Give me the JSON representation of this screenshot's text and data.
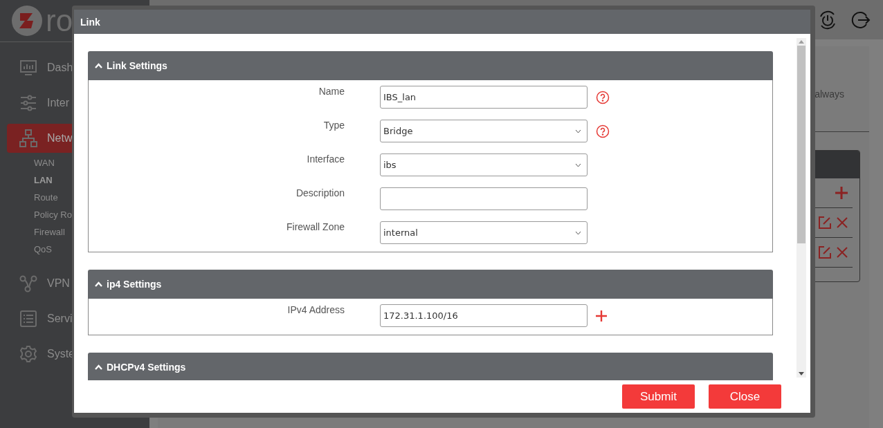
{
  "sidebar": {
    "logo_text": "ro",
    "nav": [
      {
        "label": "Dash",
        "selected": false
      },
      {
        "label": "Inter",
        "selected": false
      },
      {
        "label": "Netw",
        "selected": true,
        "children": [
          {
            "label": "WAN",
            "selected": false
          },
          {
            "label": "LAN",
            "selected": true
          },
          {
            "label": "Route",
            "selected": false
          },
          {
            "label": "Policy Ro",
            "selected": false
          },
          {
            "label": "Firewall",
            "selected": false
          },
          {
            "label": "QoS",
            "selected": false
          }
        ]
      },
      {
        "label": "VPN",
        "selected": false
      },
      {
        "label": "Servi",
        "selected": false
      },
      {
        "label": "Syste",
        "selected": false
      }
    ]
  },
  "background": {
    "text": "always",
    "rows": [
      {
        "kind": "add"
      },
      {
        "kind": "edit"
      },
      {
        "kind": "edit"
      }
    ]
  },
  "modal": {
    "title": "Link",
    "sections": [
      {
        "title": "Link Settings",
        "expanded": true,
        "fields": [
          {
            "label": "Name",
            "kind": "text",
            "value": "IBS_lan",
            "help": true
          },
          {
            "label": "Type",
            "kind": "select",
            "value": "Bridge",
            "help": true
          },
          {
            "label": "Interface",
            "kind": "select",
            "value": "ibs",
            "help": false
          },
          {
            "label": "Description",
            "kind": "text",
            "help": false
          },
          {
            "label": "Firewall Zone",
            "kind": "select",
            "value": "internal",
            "help": false
          }
        ]
      },
      {
        "title": "ip4 Settings",
        "expanded": true,
        "fields": [
          {
            "label": "IPv4 Address",
            "kind": "text",
            "value": "172.31.1.100/16",
            "help": false,
            "add": true
          }
        ]
      },
      {
        "title": "DHCPv4 Settings",
        "expanded": true
      }
    ],
    "buttons": [
      {
        "label": "Submit"
      },
      {
        "label": "Close"
      }
    ]
  }
}
